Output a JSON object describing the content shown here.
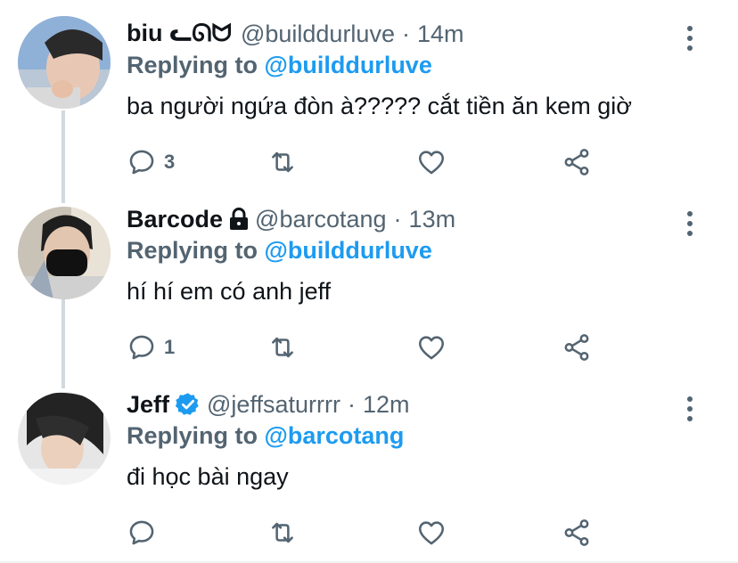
{
  "tweets": [
    {
      "name": "biu ᓚᘏᗢ",
      "handle": "@builddurluve",
      "time": "14m",
      "replying_prefix": "Replying to",
      "replying_to": "@builddurluve",
      "text": "ba người ngứa đòn à????? cắt tiền ăn kem giờ",
      "reply_count": "3",
      "badge": ""
    },
    {
      "name": "Barcode",
      "handle": "@barcotang",
      "time": "13m",
      "replying_prefix": "Replying to",
      "replying_to": "@builddurluve",
      "text": "hí hí em có anh jeff",
      "reply_count": "1",
      "badge": "lock-icon"
    },
    {
      "name": "Jeff",
      "handle": "@jeffsaturrrr",
      "time": "12m",
      "replying_prefix": "Replying to",
      "replying_to": "@barcotang",
      "text": "đi học bài ngay",
      "reply_count": "",
      "badge": "verified-badge-icon"
    }
  ],
  "dot": "·",
  "colors": {
    "link": "#1d9bf0",
    "secondary": "#536471",
    "primary": "#0f1419",
    "thread_line": "#cfd9de"
  }
}
